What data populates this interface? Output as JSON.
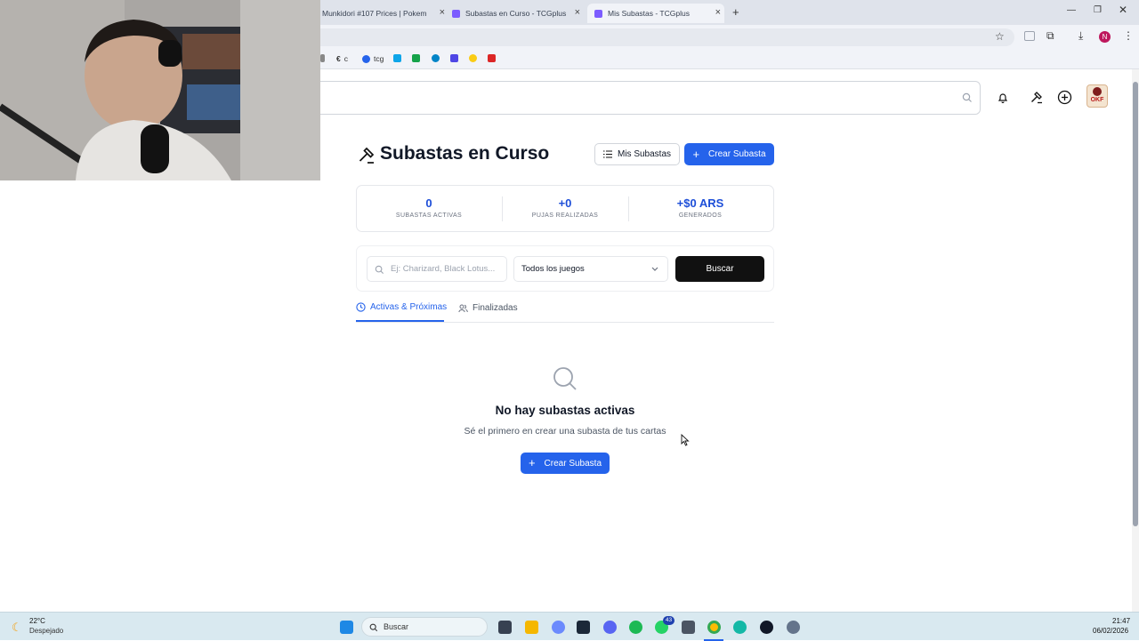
{
  "browser": {
    "tabs": [
      {
        "title": "Munkidori #107 Prices | Pokem",
        "active": false
      },
      {
        "title": "Subastas en Curso - TCGplus",
        "active": false
      },
      {
        "title": "Mis Subastas - TCGplus",
        "active": true
      }
    ],
    "new_tab_label": "+",
    "bookmarks": [
      "c",
      "tcg"
    ]
  },
  "page": {
    "title": "Subastas en Curso",
    "header_buttons": {
      "mis_subastas": "Mis Subastas",
      "crear_subasta": "Crear Subasta"
    },
    "stats": [
      {
        "value": "0",
        "label": "SUBASTAS ACTIVAS"
      },
      {
        "value": "+0",
        "label": "PUJAS REALIZADAS"
      },
      {
        "value": "+$0 ARS",
        "label": "GENERADOS"
      }
    ],
    "search": {
      "placeholder": "Ej: Charizard, Black Lotus...",
      "game_filter": "Todos los juegos",
      "search_button": "Buscar"
    },
    "tabs": [
      {
        "label": "Activas & Próximas",
        "active": true
      },
      {
        "label": "Finalizadas",
        "active": false
      }
    ],
    "empty_state": {
      "title": "No hay subastas activas",
      "subtitle": "Sé el primero en crear una subasta de tus cartas",
      "button": "Crear Subasta"
    },
    "logo_text": "OKF"
  },
  "taskbar": {
    "weather_temp": "22°C",
    "weather_desc": "Despejado",
    "search_label": "Buscar",
    "time": "21:47",
    "date": "06/02/2026",
    "whatsapp_badge": "43"
  },
  "colors": {
    "accent": "#2563eb",
    "stat_value": "#1d4ed8",
    "dark_button": "#111111"
  }
}
